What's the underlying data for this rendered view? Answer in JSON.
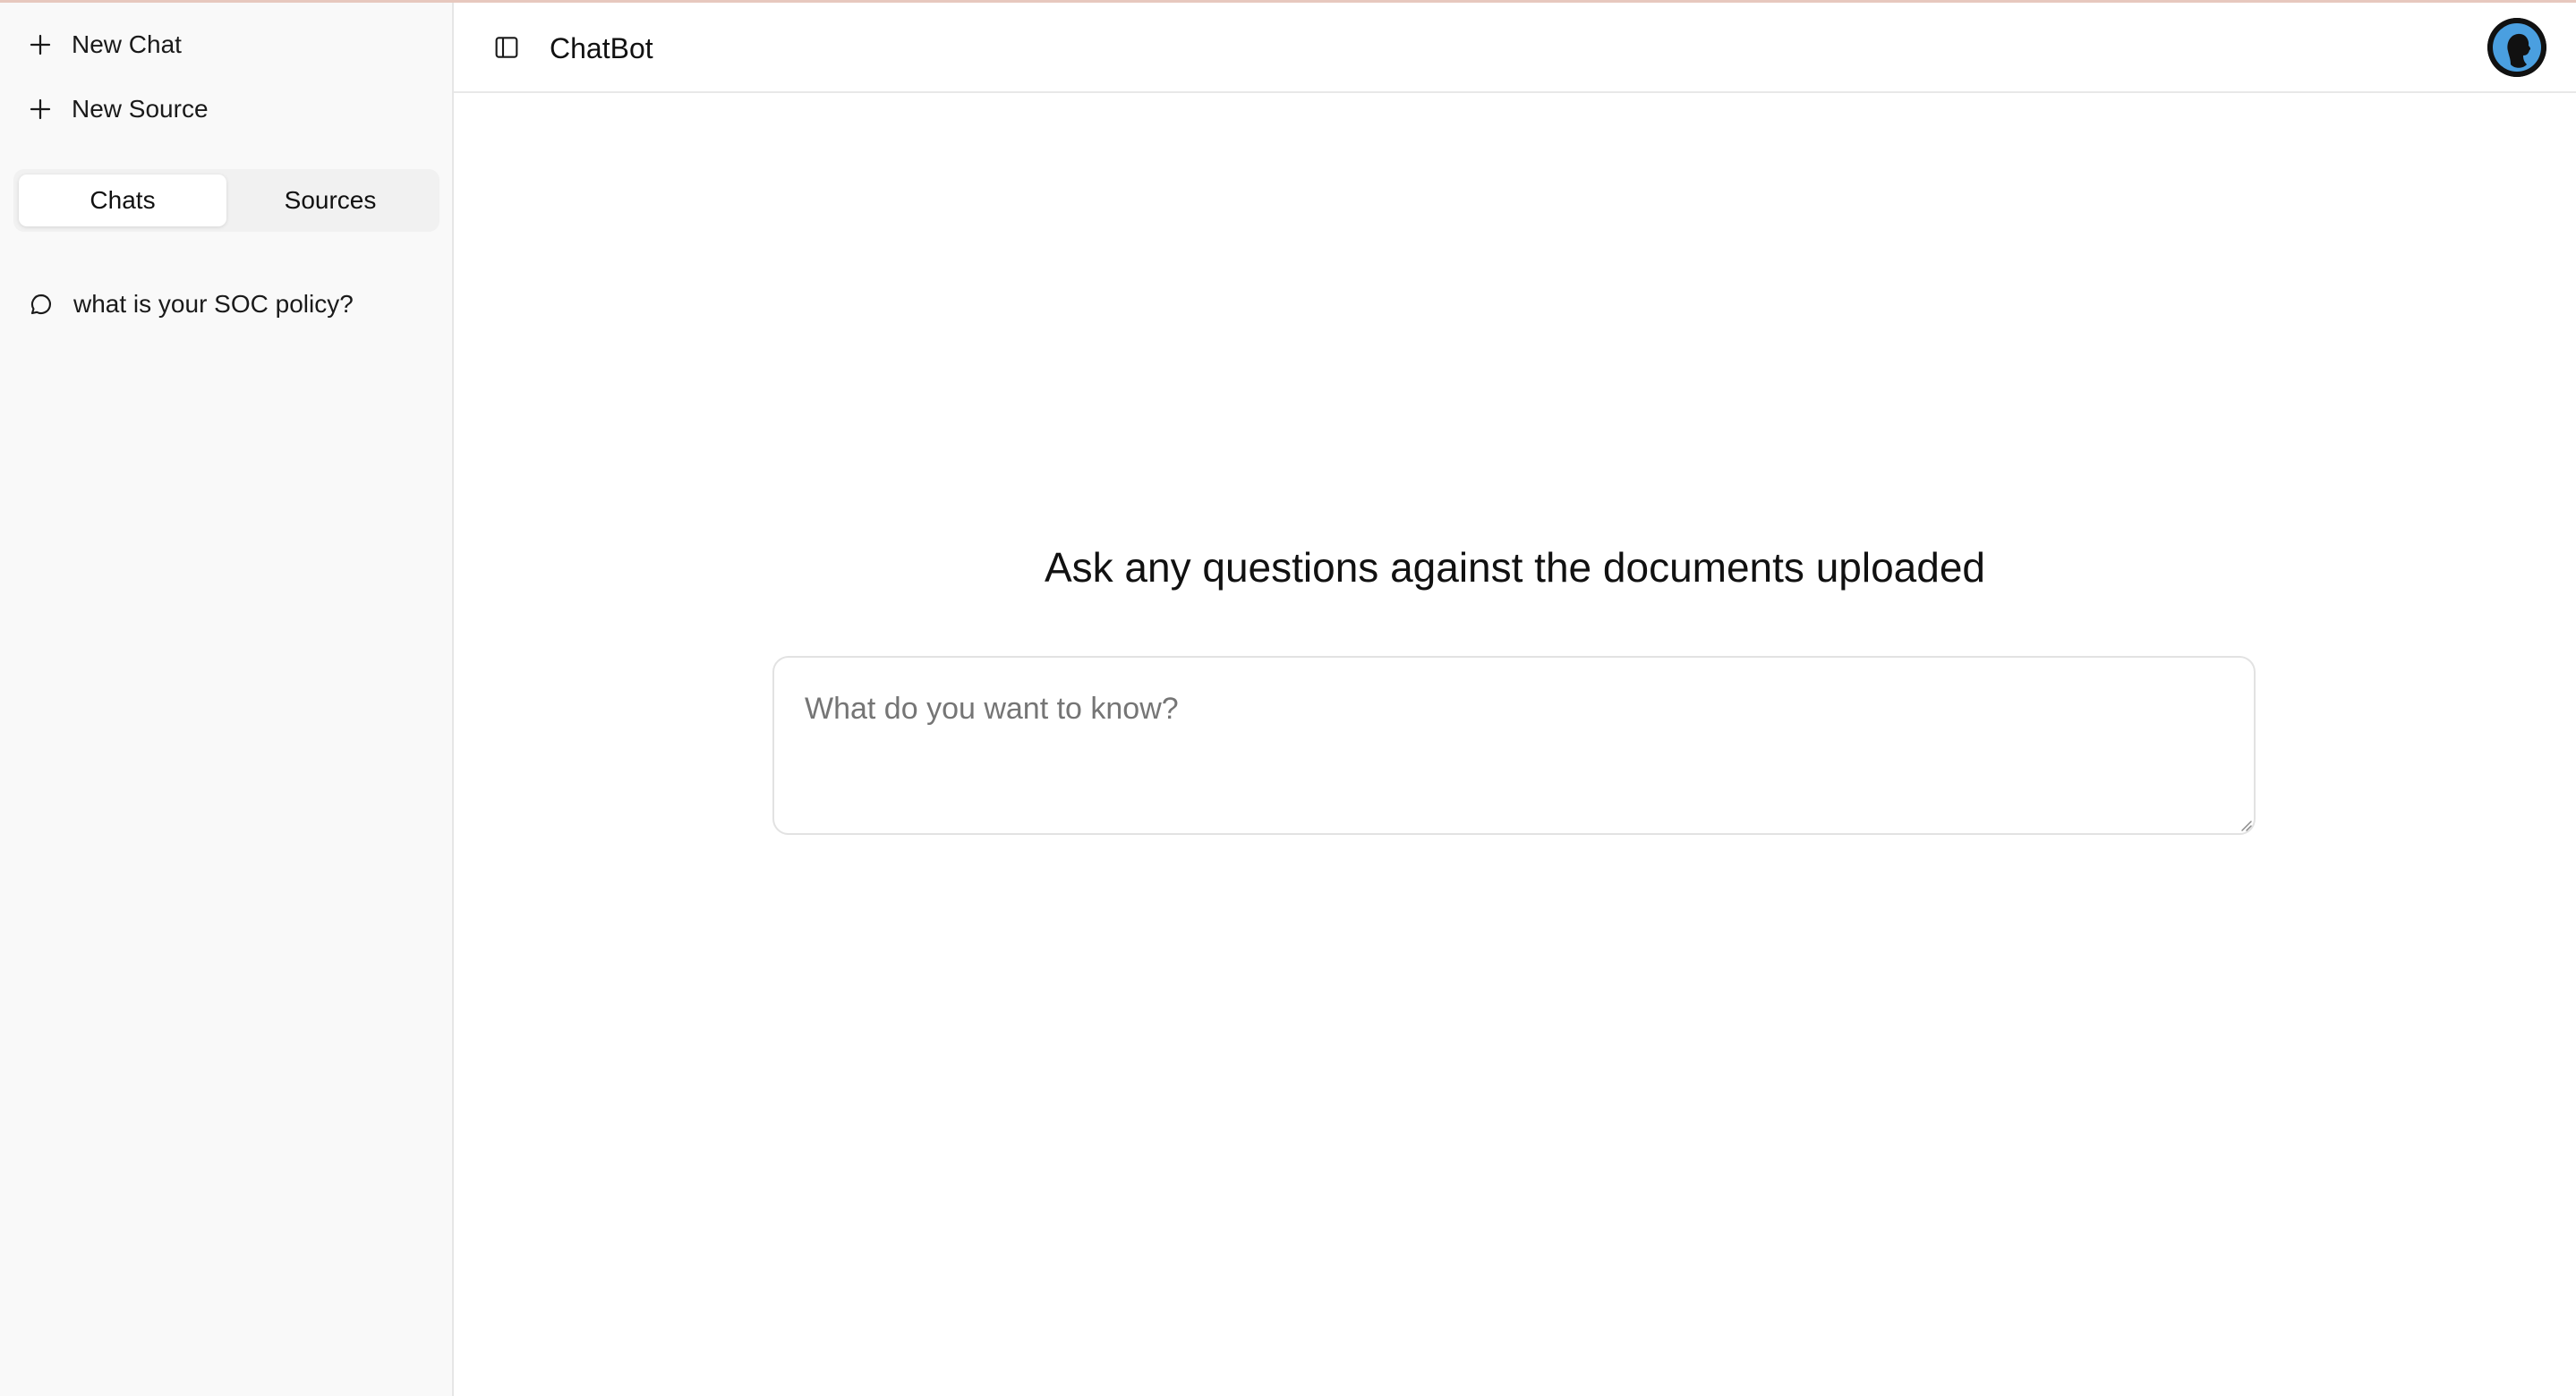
{
  "sidebar": {
    "new_chat_label": "New Chat",
    "new_source_label": "New Source",
    "tabs": [
      {
        "label": "Chats",
        "active": true
      },
      {
        "label": "Sources",
        "active": false
      }
    ],
    "chats": [
      {
        "title": "what is your SOC policy?"
      }
    ]
  },
  "header": {
    "title": "ChatBot",
    "avatar_icon": "user-silhouette-icon"
  },
  "main": {
    "headline": "Ask any questions against the documents uploaded",
    "query_placeholder": "What do you want to know?",
    "query_value": ""
  },
  "colors": {
    "sidebar_bg": "#f9f9f9",
    "avatar_accent": "#4a9fe0",
    "top_border": "#e7c8be"
  }
}
